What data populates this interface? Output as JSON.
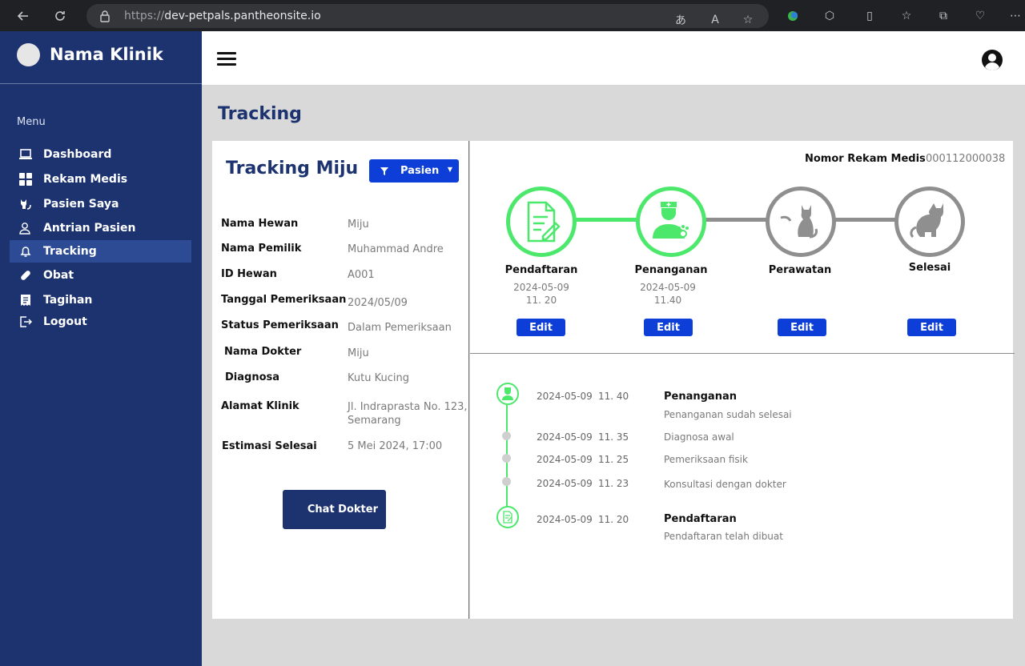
{
  "browser": {
    "url_protocol": "https://",
    "url_host": "dev-petpals.pantheonsite.io"
  },
  "sidebar": {
    "brand_name": "Nama Klinik",
    "menu_caption": "Menu",
    "items": [
      {
        "label": "Dashboard",
        "icon": "laptop-icon"
      },
      {
        "label": "Rekam Medis",
        "icon": "grid-icon"
      },
      {
        "label": "Pasien Saya",
        "icon": "cat-icon"
      },
      {
        "label": "Antrian Pasien",
        "icon": "user-queue-icon"
      },
      {
        "label": "Tracking",
        "icon": "bell-icon",
        "active": true
      },
      {
        "label": "Obat",
        "icon": "pill-icon"
      },
      {
        "label": "Tagihan",
        "icon": "invoice-icon"
      },
      {
        "label": "Logout",
        "icon": "logout-icon"
      }
    ]
  },
  "page": {
    "title": "Tracking"
  },
  "patient_card": {
    "title": "Tracking Miju",
    "filter_label": "Pasien",
    "fields": [
      {
        "label": "Nama Hewan",
        "value": "Miju"
      },
      {
        "label": "Nama Pemilik",
        "value": "Muhammad Andre"
      },
      {
        "label": "ID Hewan",
        "value": "A001"
      },
      {
        "label": "Tanggal Pemeriksaan",
        "value": "2024/05/09"
      },
      {
        "label": "Status Pemeriksaan",
        "value": "Dalam Pemeriksaan"
      },
      {
        "label": "Nama Dokter",
        "value": "Miju"
      },
      {
        "label": "Diagnosa",
        "value": "Kutu Kucing"
      },
      {
        "label": "Alamat Klinik",
        "value": "Jl. Indraprasta No. 123, Semarang"
      },
      {
        "label": "Estimasi Selesai",
        "value": "5 Mei 2024, 17:00"
      }
    ],
    "chat_button": "Chat Dokter"
  },
  "tracking": {
    "record_label": "Nomor Rekam Medis",
    "record_number": "000112000038",
    "stages": [
      {
        "name": "Pendaftaran",
        "date": "2024-05-09",
        "time": "11. 20",
        "status": "done",
        "edit": "Edit"
      },
      {
        "name": "Penanganan",
        "date": "2024-05-09",
        "time": "11.40",
        "status": "done",
        "edit": "Edit"
      },
      {
        "name": "Perawatan",
        "date": "",
        "time": "",
        "status": "todo",
        "edit": "Edit"
      },
      {
        "name": "Selesai",
        "date": "",
        "time": "",
        "status": "todo",
        "edit": "Edit"
      }
    ],
    "timeline": [
      {
        "date": "2024-05-09",
        "time": "11. 40",
        "title": "Penanganan",
        "desc": "Penanganan sudah selesai",
        "major": true
      },
      {
        "date": "2024-05-09",
        "time": "11. 35",
        "title": "",
        "desc": "Diagnosa awal",
        "major": false
      },
      {
        "date": "2024-05-09",
        "time": "11. 25",
        "title": "",
        "desc": "Pemeriksaan fisik",
        "major": false
      },
      {
        "date": "2024-05-09",
        "time": "11. 23",
        "title": "",
        "desc": "Konsultasi dengan dokter",
        "major": false
      },
      {
        "date": "2024-05-09",
        "time": "11. 20",
        "title": "Pendaftaran",
        "desc": "Pendaftaran telah dibuat",
        "major": true
      }
    ]
  },
  "colors": {
    "sidebar": "#1c3370",
    "primary_button": "#0d3fd8",
    "stage_done": "#4ce86c",
    "stage_todo": "#8f8f8f"
  }
}
